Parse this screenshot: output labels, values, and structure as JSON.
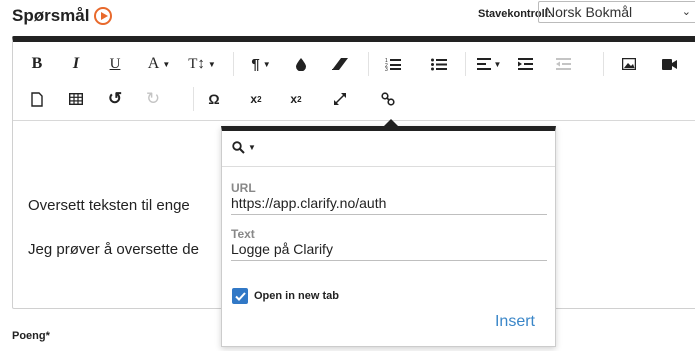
{
  "header": {
    "title": "Spørsmål"
  },
  "spellcheck": {
    "label": "Stavekontroll:",
    "value": "Norsk Bokmål"
  },
  "toolbar": {
    "row1": [
      {
        "name": "bold-button",
        "glyph": "B"
      },
      {
        "name": "italic-button",
        "glyph": "I"
      },
      {
        "name": "underline-button",
        "glyph": "U"
      },
      {
        "name": "font-color-button",
        "glyph": "A"
      },
      {
        "name": "font-size-button",
        "glyph": "TI"
      },
      {
        "name": "paragraph-button",
        "glyph": "¶"
      },
      {
        "name": "highlight-button",
        "glyph": "drop"
      },
      {
        "name": "eraser-button",
        "glyph": "eraser"
      },
      {
        "name": "ordered-list-button",
        "glyph": "ol"
      },
      {
        "name": "unordered-list-button",
        "glyph": "ul"
      },
      {
        "name": "align-button",
        "glyph": "align"
      },
      {
        "name": "indent-button",
        "glyph": "indent"
      },
      {
        "name": "outdent-button",
        "glyph": "outdent"
      },
      {
        "name": "image-button",
        "glyph": "image"
      },
      {
        "name": "video-button",
        "glyph": "video"
      }
    ],
    "row2": [
      {
        "name": "new-document-button",
        "glyph": "doc"
      },
      {
        "name": "table-button",
        "glyph": "table"
      },
      {
        "name": "undo-button",
        "glyph": "undo"
      },
      {
        "name": "redo-button",
        "glyph": "redo"
      },
      {
        "name": "special-char-button",
        "glyph": "Ω"
      },
      {
        "name": "subscript-button",
        "glyph": "x₂"
      },
      {
        "name": "superscript-button",
        "glyph": "x²"
      },
      {
        "name": "fullscreen-button",
        "glyph": "expand"
      },
      {
        "name": "link-button",
        "glyph": "link"
      }
    ]
  },
  "content": {
    "line1": "Oversett teksten til enge",
    "line2": "Jeg prøver å oversette de"
  },
  "link_popup": {
    "url_label": "URL",
    "url_value": "https://app.clarify.no/auth",
    "text_label": "Text",
    "text_value": "Logge på Clarify",
    "checkbox_label": "Open in new tab",
    "checkbox_checked": true,
    "insert_label": "Insert"
  },
  "footer": {
    "poeng_label": "Poeng*"
  },
  "colors": {
    "accent": "#e8692c",
    "primary_blue": "#3178c6",
    "link_blue": "#3a86c8"
  }
}
